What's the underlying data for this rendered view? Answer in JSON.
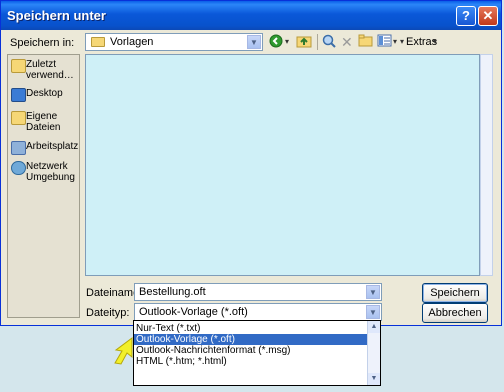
{
  "window": {
    "title": "Speichern unter",
    "help_glyph": "?",
    "close_glyph": "✕"
  },
  "toolbar": {
    "save_in_label": "Speichern in:",
    "save_in_value": "Vorlagen",
    "extras_label": "Extras"
  },
  "places": [
    {
      "label": "Zuletzt verwend…",
      "icon": "recent-folder-icon"
    },
    {
      "label": "Desktop",
      "icon": "desktop-icon"
    },
    {
      "label": "Eigene Dateien",
      "icon": "my-documents-icon"
    },
    {
      "label": "Arbeitsplatz",
      "icon": "my-computer-icon"
    },
    {
      "label": "Netzwerk Umgebung",
      "icon": "network-icon"
    }
  ],
  "filename": {
    "label": "Dateiname:",
    "value": "Bestellung.oft"
  },
  "filetype": {
    "label": "Dateityp:",
    "value": "Outlook-Vorlage (*.oft)",
    "options": [
      "Nur-Text (*.txt)",
      "Outlook-Vorlage (*.oft)",
      "Outlook-Nachrichtenformat (*.msg)",
      "HTML (*.htm; *.html)"
    ],
    "selected_index": 1
  },
  "buttons": {
    "save": "Speichern",
    "cancel": "Abbrechen"
  },
  "colors": {
    "titlebar": "#0a58d9",
    "selection": "#316ac5",
    "file_area": "#cff0f7",
    "pointer": "#f2f02a"
  }
}
